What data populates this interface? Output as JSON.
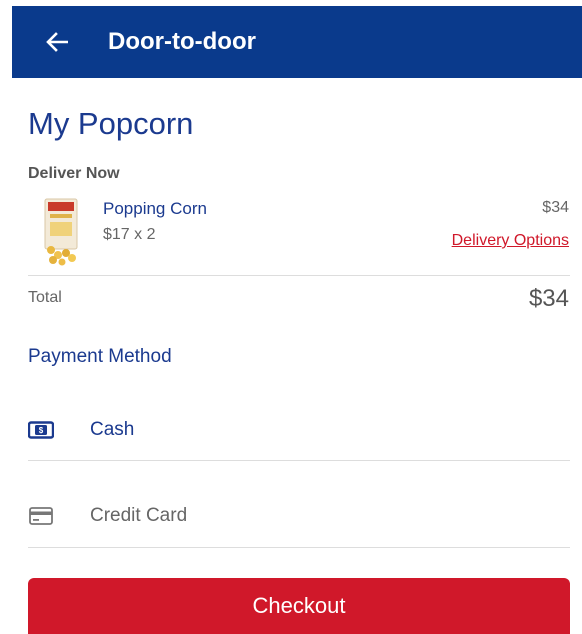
{
  "appbar": {
    "title": "Door-to-door",
    "back_icon": "arrow-left-icon",
    "color": "#0a3a8c"
  },
  "cart": {
    "title": "My Popcorn",
    "section": "Deliver Now",
    "items": [
      {
        "name": "Popping Corn",
        "qty_text": "$17 x 2",
        "price": "$34",
        "delivery_link": "Delivery Options",
        "thumbnail": "popcorn-bag-image"
      }
    ],
    "total_label": "Total",
    "total_value": "$34"
  },
  "payment": {
    "heading": "Payment Method",
    "options": [
      {
        "label": "Cash",
        "icon": "cash-icon",
        "selected": true
      },
      {
        "label": "Credit Card",
        "icon": "credit-card-icon",
        "selected": false
      }
    ]
  },
  "checkout": {
    "label": "Checkout"
  },
  "colors": {
    "accent": "#1b3a8f",
    "action_red": "#d0182a"
  }
}
